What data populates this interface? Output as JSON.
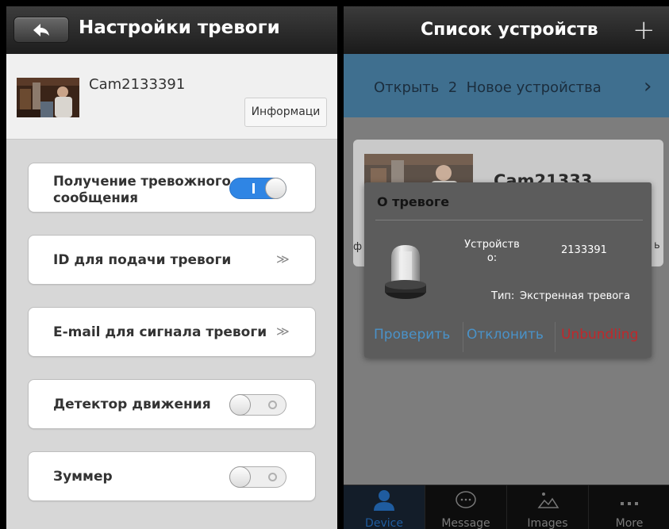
{
  "left_screen": {
    "header": {
      "title": "Настройки тревоги",
      "back_icon": "back-arrow-icon"
    },
    "camera": {
      "name": "Cam2133391",
      "info_button": "Информаци"
    },
    "settings": [
      {
        "label": "Получение тревожного сообщения",
        "control": "toggle",
        "state": "on"
      },
      {
        "label": "ID для подачи тревоги",
        "control": "arrow",
        "arrow_glyph": "≫"
      },
      {
        "label": "E-mail для сигнала тревоги",
        "control": "arrow",
        "arrow_glyph": "≫"
      },
      {
        "label": "Детектор движения",
        "control": "toggle",
        "state": "off"
      },
      {
        "label": "Зуммер",
        "control": "toggle",
        "state": "off"
      }
    ],
    "colors": {
      "toggle_on": "#2f85e4",
      "background": "#d7d7d7"
    }
  },
  "right_screen": {
    "header": {
      "title": "Список устройств",
      "add_glyph": "+"
    },
    "banner": {
      "open_label": "Открыть",
      "count": "2",
      "new_devices_label": "Новое устройства",
      "chevron": "›"
    },
    "device_card": {
      "name": "Cam21333...",
      "trailing_glyph": "o",
      "left_glyph": "ф",
      "right_glyph": "ь"
    },
    "alarm_dialog": {
      "title": "О тревоге",
      "device_label": "Устройств\nо:",
      "device_value": "2133391",
      "type_label": "Тип:",
      "type_value": "Экстренная тревога",
      "buttons": {
        "check": "Проверить",
        "reject": "Отклонить",
        "unbundling": "Unbundling"
      },
      "colors": {
        "action": "#4a92c8",
        "danger": "#c0282b"
      }
    },
    "tabs": [
      {
        "label": "Device",
        "icon": "person-icon",
        "active": true
      },
      {
        "label": "Message",
        "icon": "chat-bubble-icon",
        "active": false
      },
      {
        "label": "Images",
        "icon": "image-icon",
        "active": false
      },
      {
        "label": "More",
        "icon": "more-dots-icon",
        "active": false
      }
    ]
  }
}
